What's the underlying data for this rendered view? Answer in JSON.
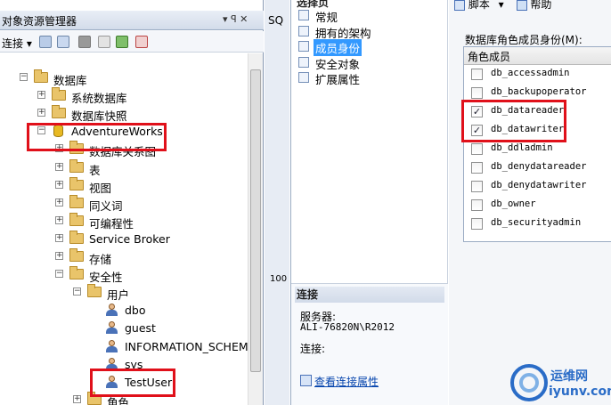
{
  "object_explorer": {
    "title": "对象资源管理器",
    "pin": "▾ ꟼ ✕",
    "connect_label": "连接 ▾",
    "tree": [
      {
        "label": "数据库",
        "icon": "folder",
        "expander": "⊟",
        "depth": 1
      },
      {
        "label": "系统数据库",
        "icon": "folder",
        "expander": "⊞",
        "depth": 2
      },
      {
        "label": "数据库快照",
        "icon": "folder",
        "expander": "⊞",
        "depth": 2
      },
      {
        "label": "AdventureWorks",
        "icon": "database",
        "expander": "⊟",
        "depth": 2,
        "highlighted": true
      },
      {
        "label": "数据库关系图",
        "icon": "folder",
        "expander": "⊞",
        "depth": 3
      },
      {
        "label": "表",
        "icon": "folder",
        "expander": "⊞",
        "depth": 3
      },
      {
        "label": "视图",
        "icon": "folder",
        "expander": "⊞",
        "depth": 3
      },
      {
        "label": "同义词",
        "icon": "folder",
        "expander": "⊞",
        "depth": 3
      },
      {
        "label": "可编程性",
        "icon": "folder",
        "expander": "⊞",
        "depth": 3
      },
      {
        "label": "Service Broker",
        "icon": "folder",
        "expander": "⊞",
        "depth": 3
      },
      {
        "label": "存储",
        "icon": "folder",
        "expander": "⊞",
        "depth": 3
      },
      {
        "label": "安全性",
        "icon": "folder",
        "expander": "⊟",
        "depth": 3
      },
      {
        "label": "用户",
        "icon": "folder",
        "expander": "⊟",
        "depth": 4
      },
      {
        "label": "dbo",
        "icon": "user",
        "depth": 5
      },
      {
        "label": "guest",
        "icon": "user",
        "depth": 5
      },
      {
        "label": "INFORMATION_SCHEMA",
        "icon": "user",
        "depth": 5
      },
      {
        "label": "sys",
        "icon": "user",
        "depth": 5
      },
      {
        "label": "TestUser",
        "icon": "user",
        "depth": 5,
        "highlighted": true
      },
      {
        "label": "角色",
        "icon": "folder",
        "expander": "⊞",
        "depth": 4
      }
    ]
  },
  "middle": {
    "tab_label": "SQ",
    "num_label": "100"
  },
  "dialog": {
    "select_page_header": "选择页",
    "pages": [
      {
        "label": "常规",
        "selected": false
      },
      {
        "label": "拥有的架构",
        "selected": false
      },
      {
        "label": "成员身份",
        "selected": true
      },
      {
        "label": "安全对象",
        "selected": false
      },
      {
        "label": "扩展属性",
        "selected": false
      }
    ],
    "connection": {
      "header": "连接",
      "server_label": "服务器:",
      "server_value": "ALI-76820N\\R2012",
      "conn_label": "连接:",
      "view_props_link": "查看连接属性"
    },
    "toolbar": {
      "script_label": "脚本",
      "help_label": "帮助"
    },
    "roles_caption": "数据库角色成员身份(M):",
    "roles_column": "角色成员",
    "roles": [
      {
        "name": "db_accessadmin",
        "checked": false
      },
      {
        "name": "db_backupoperator",
        "checked": false
      },
      {
        "name": "db_datareader",
        "checked": true
      },
      {
        "name": "db_datawriter",
        "checked": true
      },
      {
        "name": "db_ddladmin",
        "checked": false
      },
      {
        "name": "db_denydatareader",
        "checked": false
      },
      {
        "name": "db_denydatawriter",
        "checked": false
      },
      {
        "name": "db_owner",
        "checked": false
      },
      {
        "name": "db_securityadmin",
        "checked": false
      }
    ]
  },
  "watermark": {
    "line1": "运维网",
    "line2": "iyunv.com"
  },
  "colors": {
    "highlight_red": "#e0101a",
    "selection_blue": "#3399ff"
  }
}
